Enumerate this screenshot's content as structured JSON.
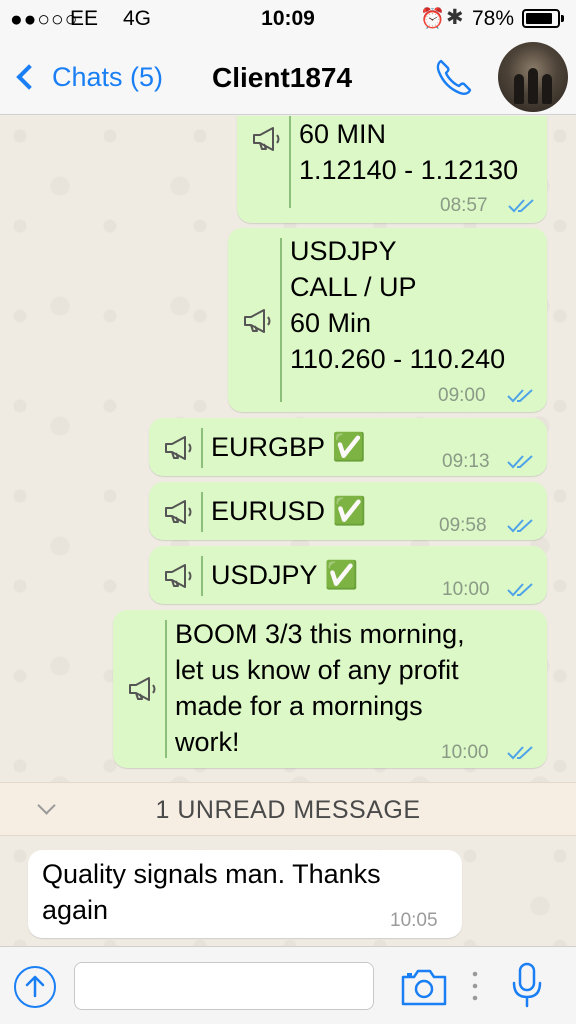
{
  "status_bar": {
    "signal": "●●○○○",
    "carrier": "EE",
    "network": "4G",
    "time": "10:09",
    "battery": "78%",
    "battery_level": 0.78
  },
  "nav": {
    "back_label": "Chats (5)",
    "title": "Client1874"
  },
  "messages": [
    {
      "text": "60 MIN\n1.12140 - 1.12130",
      "time": "08:57"
    },
    {
      "text": "USDJPY\nCALL / UP\n60 Min\n110.260 - 110.240",
      "time": "09:00"
    },
    {
      "text": "EURGBP ✅",
      "time": "09:13"
    },
    {
      "text": "EURUSD ✅",
      "time": "09:58"
    },
    {
      "text": "USDJPY ✅",
      "time": "10:00"
    },
    {
      "text": "BOOM 3/3 this morning,\nlet us know of any profit\nmade for a mornings\nwork!",
      "time": "10:00"
    }
  ],
  "unread_banner": "1 UNREAD MESSAGE",
  "incoming": {
    "text": "Quality signals man. Thanks\nagain",
    "time": "10:05"
  },
  "input": {
    "placeholder": ""
  },
  "colors": {
    "accent": "#1a7ff5",
    "outgoing_bubble": "#dcf8c6",
    "incoming_bubble": "#ffffff",
    "ticks": "#4fa3e8"
  }
}
